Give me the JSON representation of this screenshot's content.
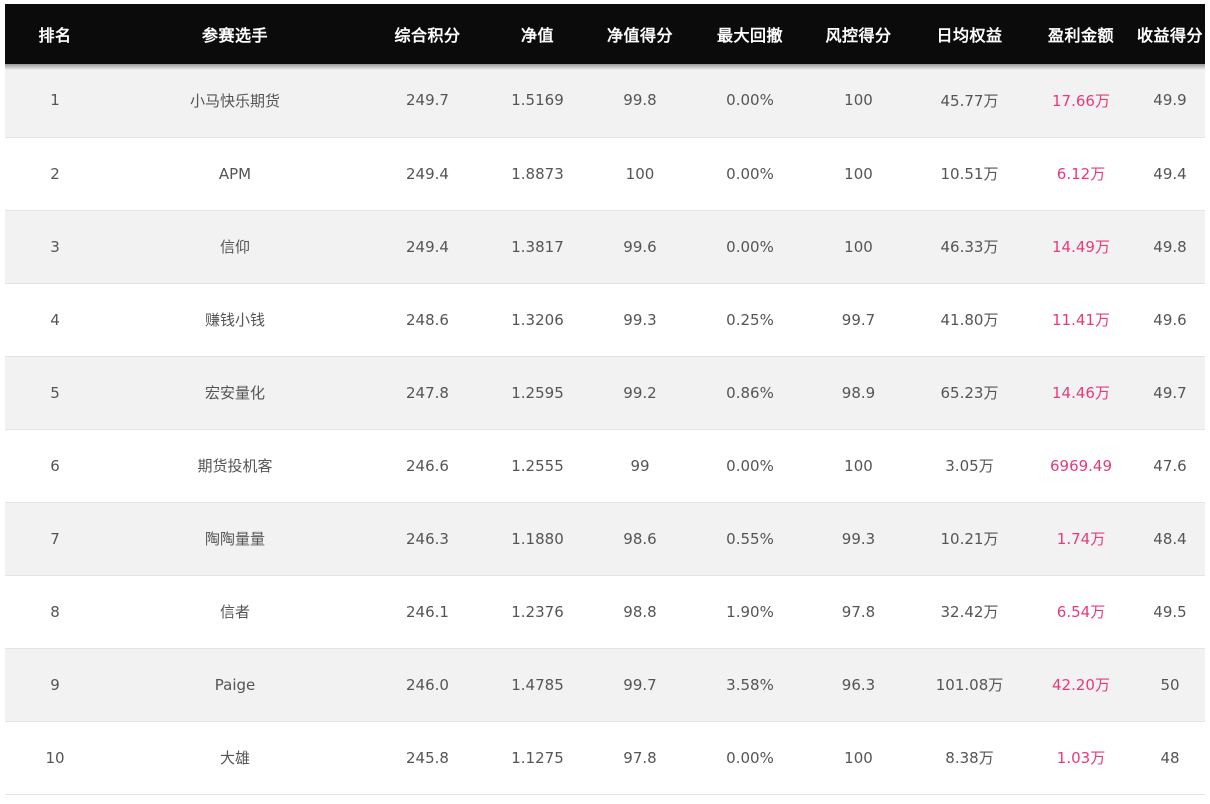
{
  "table": {
    "headers": [
      "排名",
      "参赛选手",
      "综合积分",
      "净值",
      "净值得分",
      "最大回撤",
      "风控得分",
      "日均权益",
      "盈利金额",
      "收益得分"
    ],
    "rows": [
      [
        "1",
        "小马快乐期货",
        "249.7",
        "1.5169",
        "99.8",
        "0.00%",
        "100",
        "45.77万",
        "17.66万",
        "49.9"
      ],
      [
        "2",
        "APM",
        "249.4",
        "1.8873",
        "100",
        "0.00%",
        "100",
        "10.51万",
        "6.12万",
        "49.4"
      ],
      [
        "3",
        "信仰",
        "249.4",
        "1.3817",
        "99.6",
        "0.00%",
        "100",
        "46.33万",
        "14.49万",
        "49.8"
      ],
      [
        "4",
        "赚钱小钱",
        "248.6",
        "1.3206",
        "99.3",
        "0.25%",
        "99.7",
        "41.80万",
        "11.41万",
        "49.6"
      ],
      [
        "5",
        "宏安量化",
        "247.8",
        "1.2595",
        "99.2",
        "0.86%",
        "98.9",
        "65.23万",
        "14.46万",
        "49.7"
      ],
      [
        "6",
        "期货投机客",
        "246.6",
        "1.2555",
        "99",
        "0.00%",
        "100",
        "3.05万",
        "6969.49",
        "47.6"
      ],
      [
        "7",
        "陶陶量量",
        "246.3",
        "1.1880",
        "98.6",
        "0.55%",
        "99.3",
        "10.21万",
        "1.74万",
        "48.4"
      ],
      [
        "8",
        "信者",
        "246.1",
        "1.2376",
        "98.8",
        "1.90%",
        "97.8",
        "32.42万",
        "6.54万",
        "49.5"
      ],
      [
        "9",
        "Paige",
        "246.0",
        "1.4785",
        "99.7",
        "3.58%",
        "96.3",
        "101.08万",
        "42.20万",
        "50"
      ],
      [
        "10",
        "大雄",
        "245.8",
        "1.1275",
        "97.8",
        "0.00%",
        "100",
        "8.38万",
        "1.03万",
        "48"
      ]
    ]
  },
  "colors": {
    "header_bg": "#0b0b0b",
    "header_text": "#ffffff",
    "row_odd_bg": "#f2f2f2",
    "row_even_bg": "#ffffff",
    "cell_text": "#555555",
    "profit_text": "#e8397d"
  }
}
